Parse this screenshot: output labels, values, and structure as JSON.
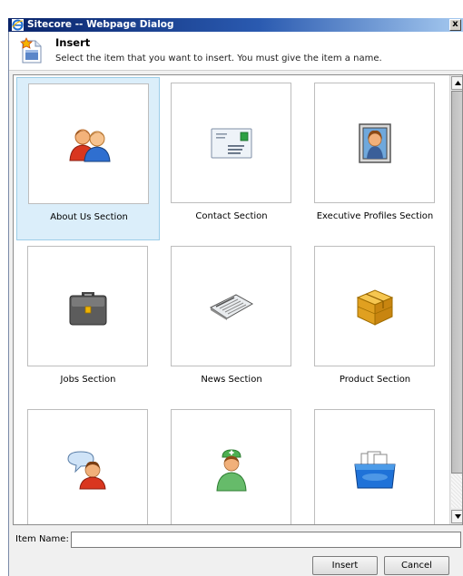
{
  "window": {
    "title": "Sitecore -- Webpage Dialog",
    "close_glyph": "x"
  },
  "header": {
    "title": "Insert",
    "description": "Select the item that you want to insert. You must give the item a name.",
    "icon": "insert-document-icon"
  },
  "tiles": [
    {
      "label": "About Us Section",
      "icon": "people-pair-icon",
      "selected": true
    },
    {
      "label": "Contact Section",
      "icon": "envelope-icon",
      "selected": false
    },
    {
      "label": "Executive Profiles Section",
      "icon": "portrait-icon",
      "selected": false
    },
    {
      "label": "Jobs Section",
      "icon": "briefcase-icon",
      "selected": false
    },
    {
      "label": "News Section",
      "icon": "newspaper-icon",
      "selected": false
    },
    {
      "label": "Product Section",
      "icon": "package-box-icon",
      "selected": false
    },
    {
      "label": "",
      "icon": "chat-person-icon",
      "selected": false
    },
    {
      "label": "",
      "icon": "nurse-icon",
      "selected": false
    },
    {
      "label": "",
      "icon": "card-file-icon",
      "selected": false
    }
  ],
  "item_name": {
    "label": "Item Name:",
    "value": ""
  },
  "buttons": {
    "insert": "Insert",
    "cancel": "Cancel"
  },
  "colors": {
    "titlebar_start": "#0a246a",
    "titlebar_end": "#a6caf0",
    "selection": "#dbeefa"
  }
}
